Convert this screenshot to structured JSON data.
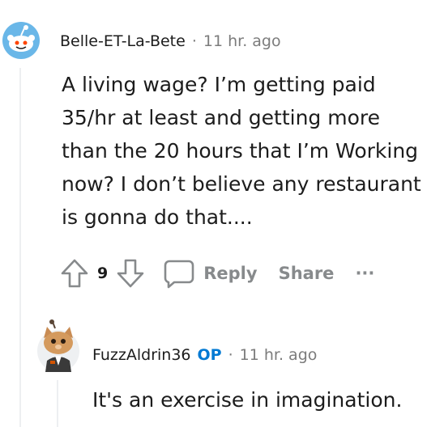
{
  "comments": [
    {
      "username": "Belle-ET-La-Bete",
      "separator": "·",
      "timestamp": "11 hr. ago",
      "body_lines": [
        "A living wage? I’m getting paid",
        "35/hr at least and getting more",
        "than the 20 hours that I’m Working",
        "now? I don’t believe any restaurant",
        "is gonna do that...."
      ],
      "votes": "9",
      "reply_label": "Reply",
      "share_label": "Share",
      "more_label": "···"
    },
    {
      "username": "FuzzAldrin36",
      "op_badge": "OP",
      "separator": "·",
      "timestamp": "11 hr. ago",
      "body": "It's an exercise in imagination."
    }
  ],
  "colors": {
    "accent": "#0079d3",
    "meta_gray": "#7c7c7c",
    "action_gray": "#878a8c",
    "thread_line": "#edeff1"
  },
  "icons": [
    "snoo-avatar",
    "cat-avatar",
    "upvote-icon",
    "downvote-icon",
    "comment-icon",
    "more-icon"
  ]
}
